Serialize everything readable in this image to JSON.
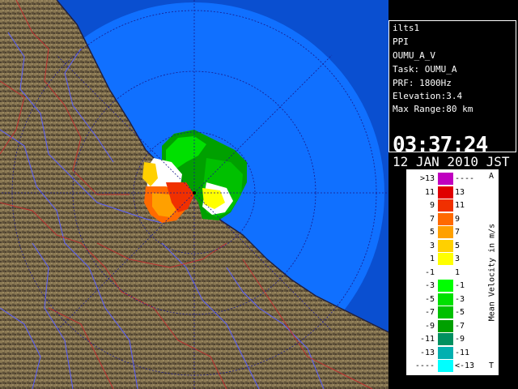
{
  "info": {
    "site": "ilts1",
    "scan_type": "PPI",
    "product": "OUMU_A_V",
    "task": "Task: OUMU_A",
    "prf": "PRF: 1800Hz",
    "elevation": "Elevation:3.4",
    "max_range": "Max Range:80 km",
    "time": "03:37:24",
    "date": "12 JAN 2010 JST"
  },
  "legend": {
    "title": "Mean Velocity in m/s",
    "top_mark": "A",
    "bottom_mark": "T",
    "rows": [
      {
        "left": ">13",
        "right": "----",
        "color": "#c000c0"
      },
      {
        "left": "11",
        "right": "13",
        "color": "#e00000"
      },
      {
        "left": "9",
        "right": "11",
        "color": "#f03000"
      },
      {
        "left": "7",
        "right": "9",
        "color": "#ff6a00"
      },
      {
        "left": "5",
        "right": "7",
        "color": "#ffa000"
      },
      {
        "left": "3",
        "right": "5",
        "color": "#ffd000"
      },
      {
        "left": "1",
        "right": "3",
        "color": "#ffff00"
      },
      {
        "left": "-1",
        "right": "1",
        "color": "#ffffff"
      },
      {
        "left": "-3",
        "right": "-1",
        "color": "#00ff00"
      },
      {
        "left": "-5",
        "right": "-3",
        "color": "#00e000"
      },
      {
        "left": "-7",
        "right": "-5",
        "color": "#00c000"
      },
      {
        "left": "-9",
        "right": "-7",
        "color": "#00a000"
      },
      {
        "left": "-11",
        "right": "-9",
        "color": "#009060"
      },
      {
        "left": "-13",
        "right": "-11",
        "color": "#00b0b0"
      },
      {
        "left": "----",
        "right": "<-13",
        "color": "#00ffff"
      }
    ]
  },
  "colors": {
    "sea": "#1070ff",
    "sea_outer": "#0a4fd0",
    "land": "#7a6a4a",
    "river": "#5a60ff",
    "border": "#c03030",
    "range_ring": "#1a1a8a"
  }
}
